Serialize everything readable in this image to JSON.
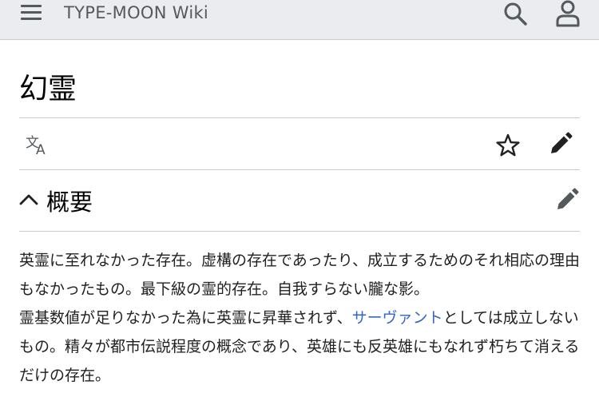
{
  "header": {
    "site_title": "TYPE-MOON Wiki",
    "menu_icon": "hamburger-menu-icon",
    "search_icon": "search-icon",
    "user_icon": "user-icon"
  },
  "page": {
    "title": "幻霊"
  },
  "page_actions": {
    "language_icon": "language-icon",
    "watch_icon": "star-icon",
    "edit_icon": "pencil-icon"
  },
  "section": {
    "title": "概要",
    "collapse_icon": "chevron-up-icon",
    "edit_icon": "pencil-icon"
  },
  "content": {
    "paragraph1": "英霊に至れなかった存在。虚構の存在であったり、成立するためのそれ相応の理由もなかったもの。最下級の霊的存在。自我すらない朧な影。",
    "paragraph2_before": "霊基数値が足りなかった為に英霊に昇華されず、",
    "paragraph2_link": "サーヴァント",
    "paragraph2_after": "としては成立しないもの。精々が都市伝説程度の概念であり、英雄にも反英雄にもなれず朽ちて消えるだけの存在。"
  },
  "colors": {
    "header_bg": "#eaecf0",
    "link": "#3366cc",
    "icon": "#54595d",
    "divider": "#c8ccd1"
  }
}
